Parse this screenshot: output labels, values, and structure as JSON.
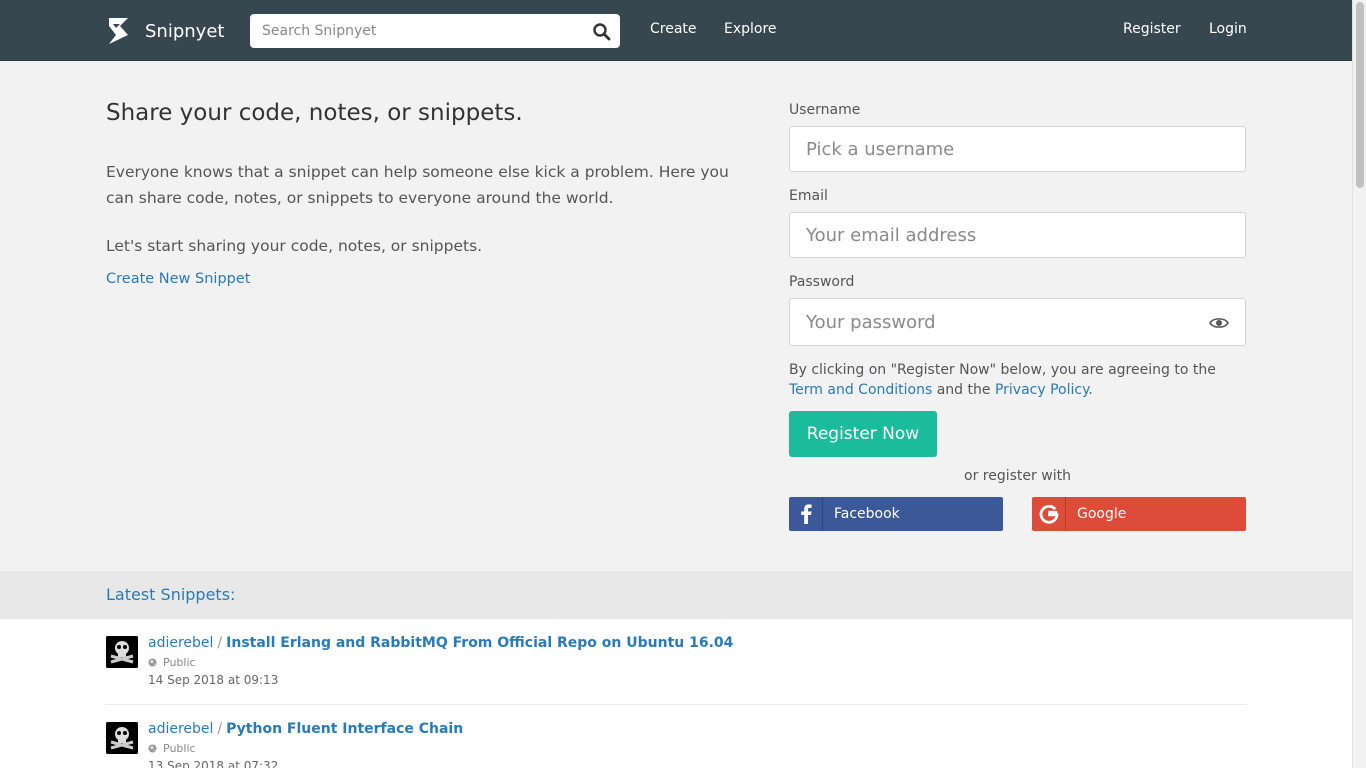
{
  "nav": {
    "brand": "Snipnyet",
    "search_placeholder": "Search Snipnyet",
    "links": [
      "Create",
      "Explore"
    ],
    "register": "Register",
    "login": "Login"
  },
  "hero": {
    "title": "Share your code, notes, or snippets.",
    "description": "Everyone knows that a snippet can help someone else kick a problem. Here you can share code, notes, or snippets to everyone around the world.",
    "cta": "Let's start sharing your code, notes, or snippets.",
    "link": "Create New Snippet"
  },
  "form": {
    "username_label": "Username",
    "username_placeholder": "Pick a username",
    "email_label": "Email",
    "email_placeholder": "Your email address",
    "password_label": "Password",
    "password_placeholder": "Your password",
    "terms_prefix": "By clicking on \"Register Now\" below, you are agreeing to the ",
    "terms_link": "Term and Conditions",
    "terms_mid": " and the ",
    "privacy_link": "Privacy Policy",
    "terms_suffix": ".",
    "register_button": "Register Now",
    "or_text": "or register with",
    "facebook": "Facebook",
    "google": "Google"
  },
  "latest": {
    "title": "Latest Snippets:",
    "items": [
      {
        "author": "adierebel",
        "sep": "/",
        "title": "Install Erlang and RabbitMQ From Official Repo on Ubuntu 16.04",
        "visibility": "Public",
        "date": "14 Sep 2018 at 09:13"
      },
      {
        "author": "adierebel",
        "sep": "/",
        "title": "Python Fluent Interface Chain",
        "visibility": "Public",
        "date": "13 Sep 2018 at 07:32"
      }
    ]
  },
  "colors": {
    "navbar": "#37474f",
    "accent": "#2a7ab8",
    "register_button": "#1abc9c",
    "facebook": "#3b5998",
    "google": "#dd4b39"
  },
  "icons": [
    "logo-icon",
    "search-icon",
    "eye-icon",
    "facebook-icon",
    "google-icon",
    "globe-icon",
    "avatar"
  ]
}
